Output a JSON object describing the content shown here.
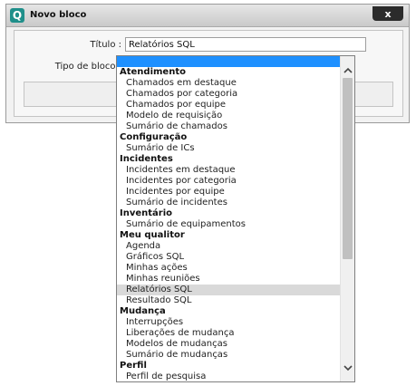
{
  "dialog": {
    "title": "Novo bloco",
    "logo_letter": "Q",
    "close_label": "x"
  },
  "form": {
    "title_label": "Título :",
    "title_value": "Relatórios SQL",
    "type_label": "Tipo de bloco :"
  },
  "dropdown": {
    "items": [
      {
        "kind": "blank",
        "label": ""
      },
      {
        "kind": "group",
        "label": "Atendimento"
      },
      {
        "kind": "option",
        "label": "Chamados em destaque"
      },
      {
        "kind": "option",
        "label": "Chamados por categoria"
      },
      {
        "kind": "option",
        "label": "Chamados por equipe"
      },
      {
        "kind": "option",
        "label": "Modelo de requisição"
      },
      {
        "kind": "option",
        "label": "Sumário de chamados"
      },
      {
        "kind": "group",
        "label": "Configuração"
      },
      {
        "kind": "option",
        "label": "Sumário de ICs"
      },
      {
        "kind": "group",
        "label": "Incidentes"
      },
      {
        "kind": "option",
        "label": "Incidentes em destaque"
      },
      {
        "kind": "option",
        "label": "Incidentes por categoria"
      },
      {
        "kind": "option",
        "label": "Incidentes por equipe"
      },
      {
        "kind": "option",
        "label": "Sumário de incidentes"
      },
      {
        "kind": "group",
        "label": "Inventário"
      },
      {
        "kind": "option",
        "label": "Sumário de equipamentos"
      },
      {
        "kind": "group",
        "label": "Meu qualitor"
      },
      {
        "kind": "option",
        "label": "Agenda"
      },
      {
        "kind": "option",
        "label": "Gráficos SQL"
      },
      {
        "kind": "option",
        "label": "Minhas ações"
      },
      {
        "kind": "option",
        "label": "Minhas reuniões"
      },
      {
        "kind": "option",
        "label": "Relatórios SQL",
        "highlighted": true
      },
      {
        "kind": "option",
        "label": "Resultado SQL"
      },
      {
        "kind": "group",
        "label": "Mudança"
      },
      {
        "kind": "option",
        "label": "Interrupções"
      },
      {
        "kind": "option",
        "label": "Liberações de mudança"
      },
      {
        "kind": "option",
        "label": "Modelos de mudanças"
      },
      {
        "kind": "option",
        "label": "Sumário de mudanças"
      },
      {
        "kind": "group",
        "label": "Perfil"
      },
      {
        "kind": "option",
        "label": "Perfil de pesquisa"
      }
    ],
    "scroll_up_icon": "chevron-up-icon",
    "scroll_down_icon": "chevron-down-icon"
  },
  "colors": {
    "selection": "#1e90ff",
    "highlight": "#d9d9d9",
    "logo": "#1f8f8a"
  }
}
